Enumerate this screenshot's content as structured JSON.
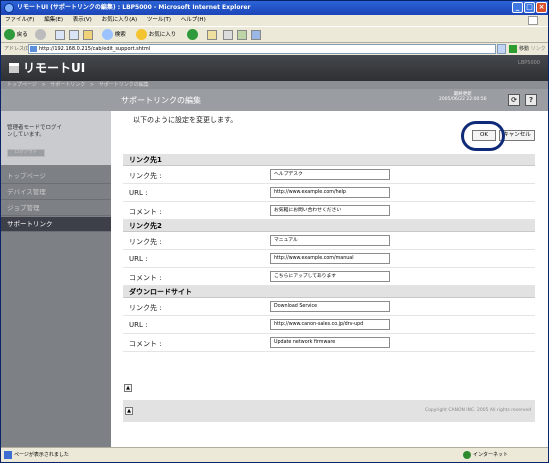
{
  "window": {
    "title": "リモートUI (サポートリンクの編集) : LBP5000 - Microsoft Internet Explorer"
  },
  "menubar": [
    "ファイル(F)",
    "編集(E)",
    "表示(V)",
    "お気に入り(A)",
    "ツール(T)",
    "ヘルプ(H)"
  ],
  "toolbar": {
    "back_label": "戻る",
    "search_label": "検索",
    "favorites_label": "お気に入り"
  },
  "address": {
    "label": "アドレス(D)",
    "url": "http://192.168.0.215/cab/edit_support.shtml",
    "go_label": "移動",
    "links_label": "リンク"
  },
  "app": {
    "logo": "リモートUI",
    "model": "LBP5000"
  },
  "breadcrumb": [
    "トップページ",
    ">",
    "サポートリンク",
    ">",
    "サポートリンクの編集"
  ],
  "page": {
    "title": "サポートリンクの編集",
    "updated_label": "最終更新",
    "updated_value": "2005/06/22 22:00:56",
    "message": "以下のように設定を変更します。",
    "ok_label": "OK",
    "cancel_label": "キャンセル"
  },
  "sidebar": {
    "login_text": "管理者モードでログインしています。",
    "logout_label": "ログアウト",
    "items": [
      {
        "label": "トップページ",
        "active": false
      },
      {
        "label": "デバイス管理",
        "active": false
      },
      {
        "label": "ジョブ管理",
        "active": false
      },
      {
        "label": "サポートリンク",
        "active": true
      }
    ]
  },
  "form": {
    "sections": [
      {
        "heading": "リンク先1",
        "rows": [
          {
            "label": "リンク先 :",
            "value": "ヘルプデスク"
          },
          {
            "label": "URL :",
            "value": "http://www.example.com/help"
          },
          {
            "label": "コメント :",
            "value": "お気軽にお問い合わせください"
          }
        ]
      },
      {
        "heading": "リンク先2",
        "rows": [
          {
            "label": "リンク先 :",
            "value": "マニュアル"
          },
          {
            "label": "URL :",
            "value": "http://www.example.com/manual"
          },
          {
            "label": "コメント :",
            "value": "こちらにアップしてあります"
          }
        ]
      },
      {
        "heading": "ダウンロードサイト",
        "rows": [
          {
            "label": "リンク先 :",
            "value": "Download Service"
          },
          {
            "label": "URL :",
            "value": "http://www.canon-sales.co.jp/drv-upd"
          },
          {
            "label": "コメント :",
            "value": "Update network firmware"
          }
        ]
      }
    ]
  },
  "footer": {
    "copyright": "Copyright CANON INC. 2005 All rights reserved"
  },
  "status": {
    "left": "ページが表示されました",
    "right": "インターネット"
  }
}
